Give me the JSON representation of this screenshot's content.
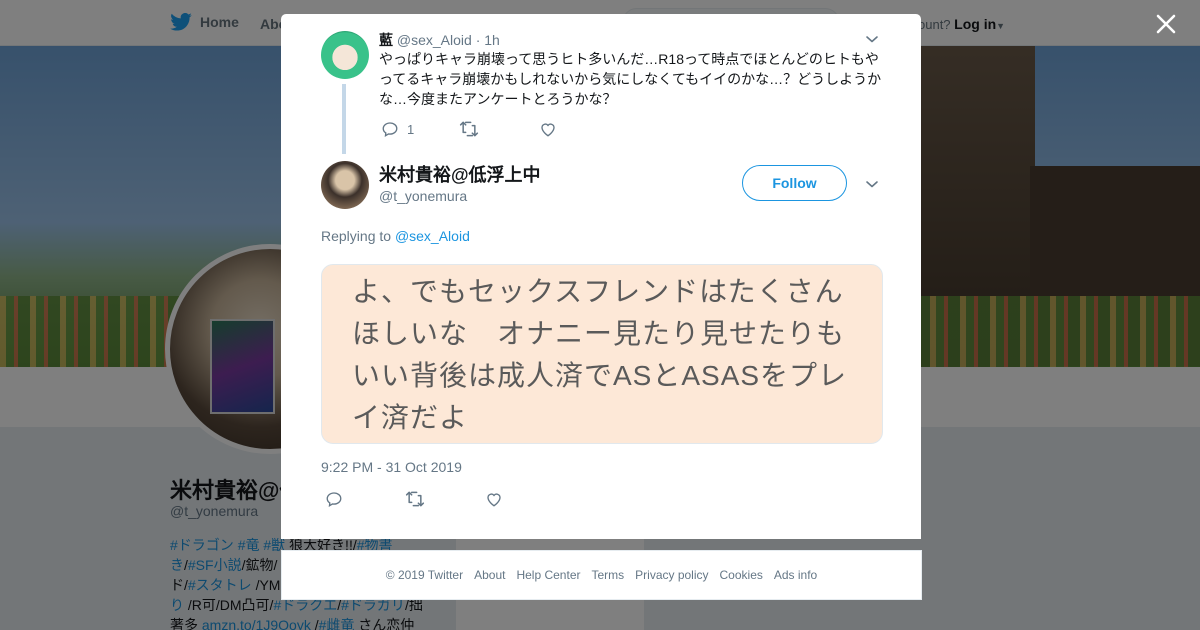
{
  "background": {
    "nav": {
      "home": "Home",
      "about": "Abo",
      "have_account": "ccount?",
      "login": "Log in"
    },
    "profile": {
      "name": "米村貴裕@低",
      "handle": "@t_yonemura",
      "bio_lines": [
        [
          {
            "t": "#ドラゴン",
            "tag": true
          },
          {
            "t": " ",
            "tag": false
          },
          {
            "t": "#竜",
            "tag": true
          },
          {
            "t": " ",
            "tag": false
          },
          {
            "t": "#獣",
            "tag": true
          },
          {
            "t": " 狼大好き!!/",
            "tag": false
          },
          {
            "t": "#物書",
            "tag": true
          }
        ],
        [
          {
            "t": "き",
            "tag": true
          },
          {
            "t": "/",
            "tag": false
          },
          {
            "t": "#SF小説",
            "tag": true
          },
          {
            "t": "/鉱物/",
            "tag": false
          }
        ],
        [
          {
            "t": "ド/",
            "tag": false
          },
          {
            "t": "#スタトレ",
            "tag": true
          },
          {
            "t": " /YM",
            "tag": false
          }
        ],
        [
          {
            "t": "り",
            "tag": true
          },
          {
            "t": " /R可/DM凸可/",
            "tag": false
          },
          {
            "t": "#ドラクエ",
            "tag": true
          },
          {
            "t": "/",
            "tag": false
          },
          {
            "t": "#ドラガリ",
            "tag": true
          },
          {
            "t": "/拙",
            "tag": false
          }
        ],
        [
          {
            "t": "著多 ",
            "tag": false
          },
          {
            "t": "amzn.to/1J9Ooyk",
            "tag": true
          },
          {
            "t": " /",
            "tag": false
          },
          {
            "t": "#雌竜",
            "tag": true
          },
          {
            "t": " さん恋仲",
            "tag": false
          }
        ]
      ]
    }
  },
  "modal": {
    "parent_tweet": {
      "name": "藍",
      "handle": "@sex_Aloid",
      "separator": "·",
      "time": "1h",
      "text": "やっぱりキャラ崩壊って思うヒト多いんだ…R18って時点でほとんどのヒトもやってるキャラ崩壊かもしれないから気にしなくてもイイのかな…？どうしようかな…今度またアンケートとろうかな？",
      "reply_count": "1"
    },
    "main_tweet": {
      "name": "米村貴裕@低浮上中",
      "handle": "@t_yonemura",
      "follow_label": "Follow",
      "replying_prefix": "Replying to",
      "replying_to": "@sex_Aloid",
      "media_text": "よ、でもセックスフレンドはたくさんほしいな　オナニー見たり見せたりもいい背後は成人済でASとASASをプレイ済だよ",
      "timestamp": "9:22 PM - 31 Oct 2019"
    }
  },
  "footer": {
    "copyright": "© 2019 Twitter",
    "about": "About",
    "help": "Help Center",
    "terms": "Terms",
    "privacy": "Privacy policy",
    "cookies": "Cookies",
    "ads": "Ads info"
  },
  "colors": {
    "accent": "#1b95e0",
    "secondary_text": "#657786",
    "media_bg": "#fde8d7"
  }
}
